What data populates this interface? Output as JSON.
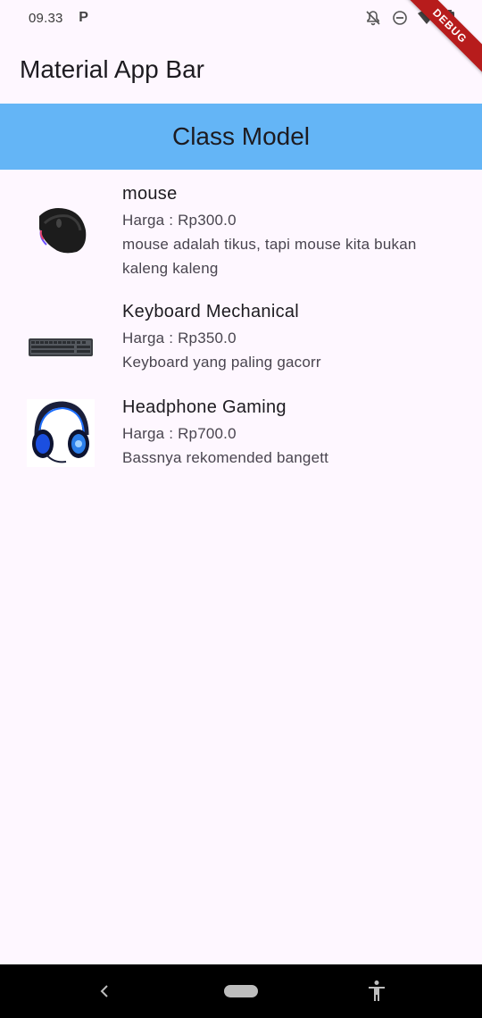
{
  "status_bar": {
    "time": "09.33",
    "app_icon": "P",
    "icons": [
      "notifications-off-icon",
      "do-not-disturb-icon",
      "wifi-icon",
      "battery-icon"
    ]
  },
  "debug_banner": "DEBUG",
  "app_bar": {
    "title": "Material App Bar"
  },
  "header": {
    "title": "Class Model",
    "color": "#64B5F6"
  },
  "products": [
    {
      "name": "mouse",
      "price": "Harga : Rp300.0",
      "description_lines": [
        "mouse adalah tikus, tapi mouse kita bukan",
        "kaleng kaleng"
      ],
      "image": "gaming-mouse-image"
    },
    {
      "name": "Keyboard Mechanical",
      "price": "Harga : Rp350.0",
      "description_lines": [
        "Keyboard yang paling gacorr"
      ],
      "image": "keyboard-image"
    },
    {
      "name": "Headphone Gaming",
      "price": "Harga : Rp700.0",
      "description_lines": [
        "Bassnya rekomended bangett"
      ],
      "image": "gaming-headphone-image"
    }
  ],
  "colors": {
    "background": "#FEF7FF",
    "text_primary": "#1D1B20",
    "text_secondary": "#49454F",
    "debug": "#B71C1C"
  }
}
